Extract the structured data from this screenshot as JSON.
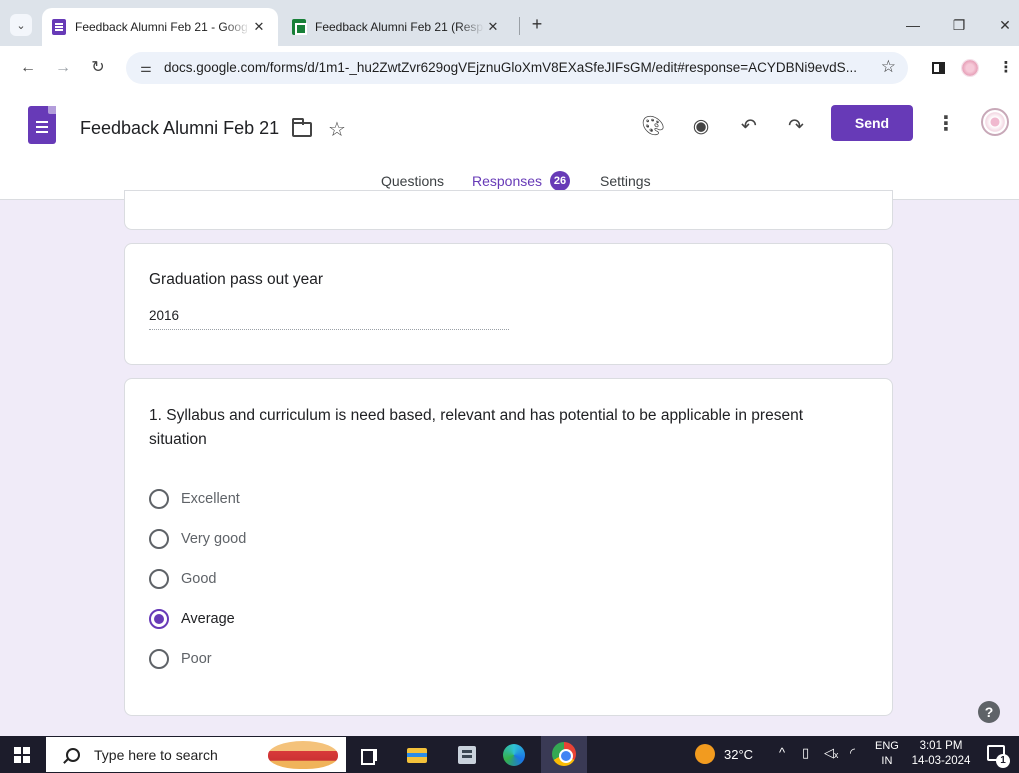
{
  "browser": {
    "tabs": [
      {
        "title": "Feedback Alumni Feb 21 - Goog",
        "icon": "google-forms-icon",
        "active": true
      },
      {
        "title": "Feedback Alumni Feb 21 (Respo",
        "icon": "google-sheets-icon",
        "active": false
      }
    ],
    "tab_close_glyph": "✕",
    "new_tab_glyph": "+",
    "url": "docs.google.com/forms/d/1m1-_hu2ZwtZvr629ogVEjznuGloXmV8EXaSfeJIFsGM/edit#response=ACYDBNi9evdS..."
  },
  "forms": {
    "title": "Feedback Alumni Feb 21",
    "send_label": "Send",
    "tabs": {
      "questions": "Questions",
      "responses": "Responses",
      "responses_count": "26",
      "settings": "Settings"
    },
    "accent_color": "#673ab7"
  },
  "questions": {
    "year": {
      "label": "Graduation pass out year",
      "answer": "2016"
    },
    "q1": {
      "label": "1.   Syllabus and curriculum is need based, relevant and has potential to be applicable in present situation",
      "options": [
        {
          "label": "Excellent",
          "selected": false
        },
        {
          "label": "Very good",
          "selected": false
        },
        {
          "label": "Good",
          "selected": false
        },
        {
          "label": "Average",
          "selected": true
        },
        {
          "label": "Poor",
          "selected": false
        }
      ]
    }
  },
  "help_glyph": "?",
  "taskbar": {
    "search_placeholder": "Type here to search",
    "temperature": "32°C",
    "lang_line1": "ENG",
    "lang_line2": "IN",
    "time": "3:01 PM",
    "date": "14-03-2024",
    "notification_count": "1"
  }
}
